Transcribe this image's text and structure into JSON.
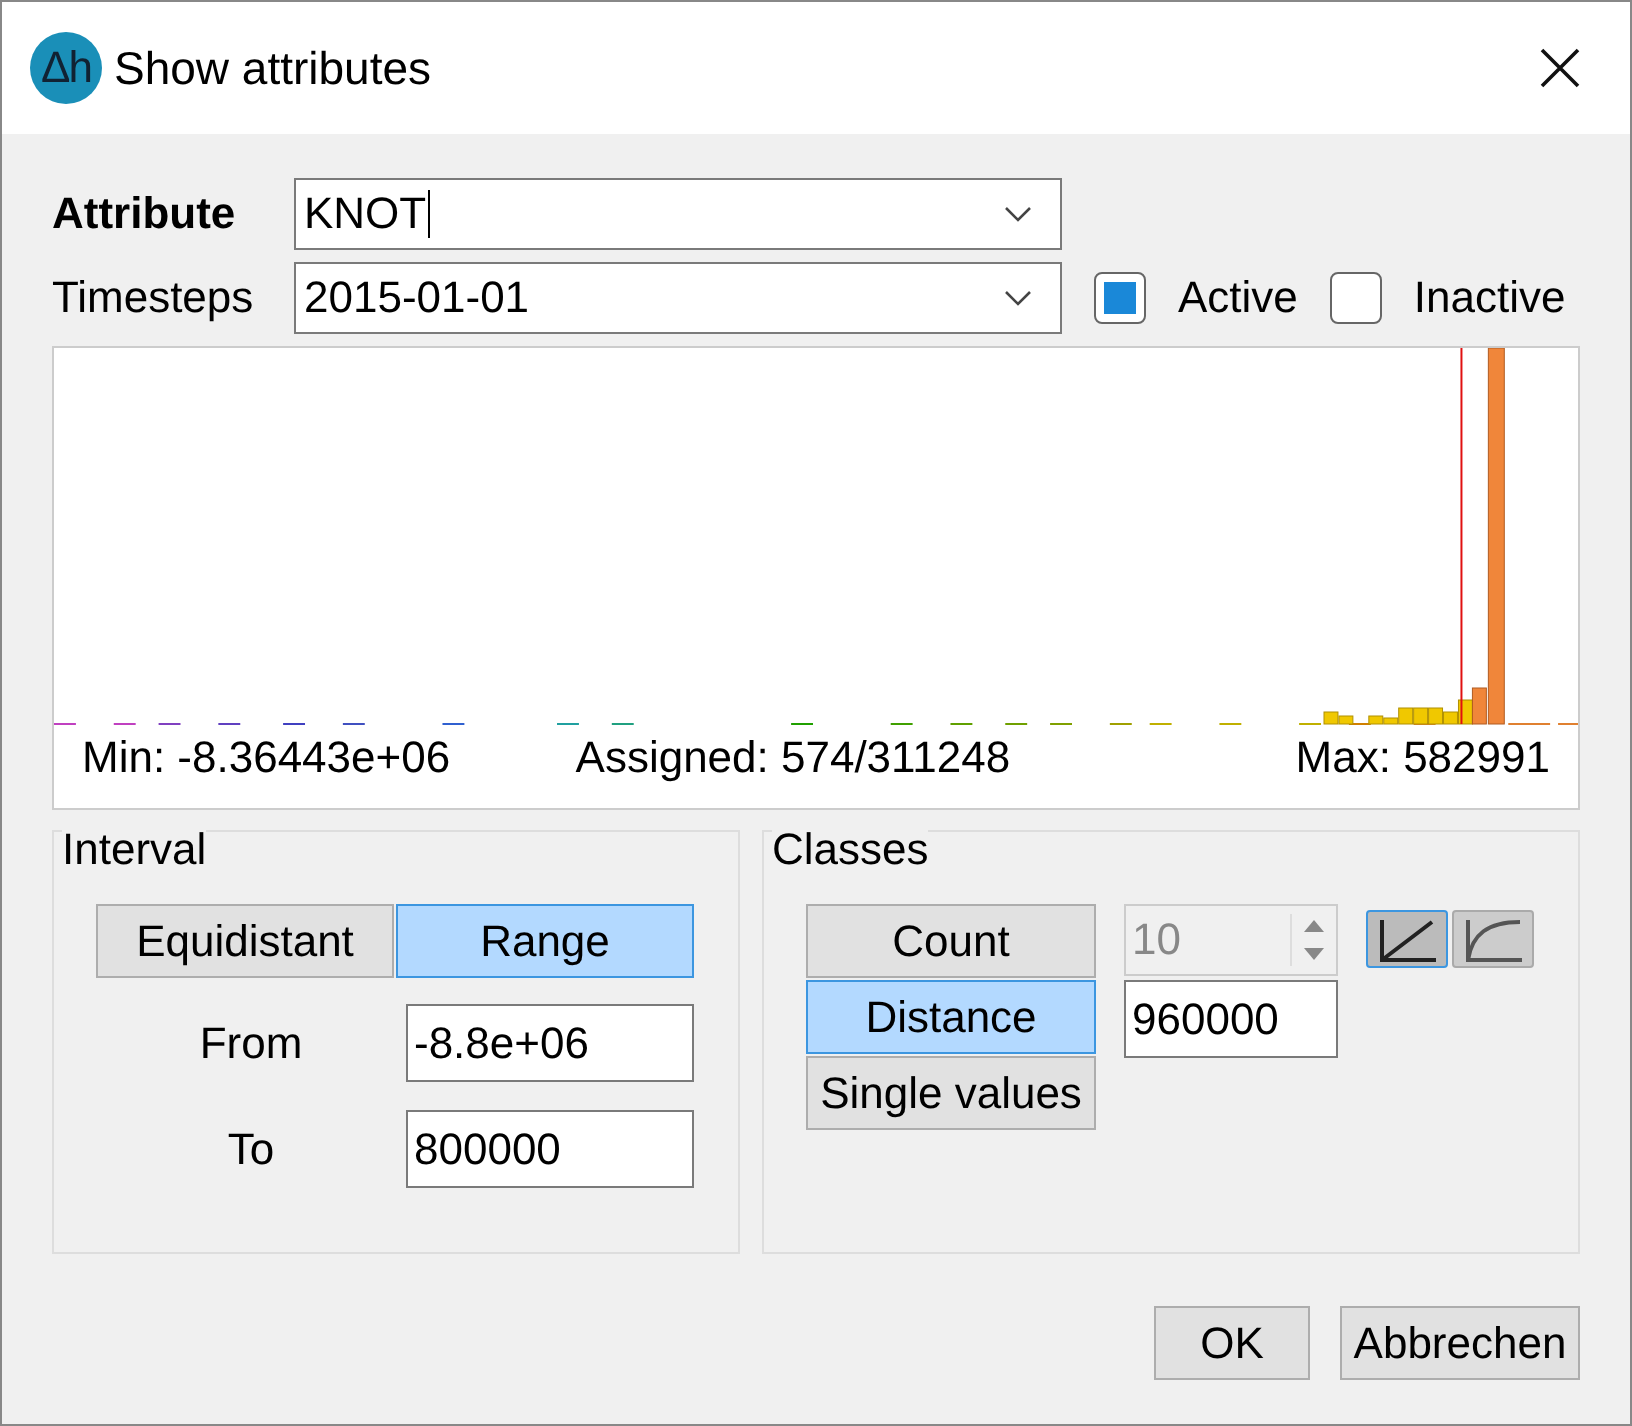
{
  "window": {
    "icon_text": "Δh",
    "title": "Show attributes"
  },
  "attribute": {
    "label": "Attribute",
    "value": "KNOT"
  },
  "timesteps": {
    "label": "Timesteps",
    "value": "2015-01-01"
  },
  "filters": [
    {
      "label": "Active",
      "checked": true
    },
    {
      "label": "Inactive",
      "checked": false
    }
  ],
  "histogram": {
    "min": "Min: -8.36443e+06",
    "assigned": "Assigned: 574/311248",
    "max": "Max: 582991"
  },
  "interval": {
    "title": "Interval",
    "modes": [
      {
        "label": "Equidistant",
        "selected": false
      },
      {
        "label": "Range",
        "selected": true
      }
    ],
    "fields": [
      {
        "label": "From",
        "value": "-8.8e+06"
      },
      {
        "label": "To",
        "value": "800000"
      }
    ]
  },
  "classes": {
    "title": "Classes",
    "modes": [
      {
        "label": "Count",
        "selected": false
      },
      {
        "label": "Distance",
        "selected": true
      },
      {
        "label": "Single values",
        "selected": false
      }
    ],
    "count": {
      "value": "10",
      "disabled": true
    },
    "distance": {
      "value": "960000"
    },
    "curves": [
      {
        "kind": "linear",
        "selected": true
      },
      {
        "kind": "curve",
        "selected": false
      }
    ]
  },
  "buttons": [
    "OK",
    "Abbrechen"
  ]
}
